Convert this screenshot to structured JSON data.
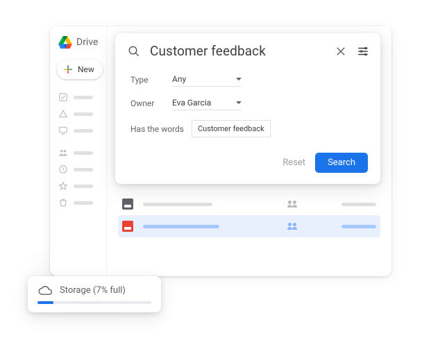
{
  "brand": {
    "name": "Drive"
  },
  "sidebar": {
    "new_label": "New"
  },
  "search": {
    "query": "Customer feedback",
    "filters": {
      "type_label": "Type",
      "type_value": "Any",
      "owner_label": "Owner",
      "owner_value": "Eva Garcia",
      "words_label": "Has the words",
      "words_value": "Customer feedback"
    },
    "actions": {
      "reset": "Reset",
      "search": "Search"
    }
  },
  "storage": {
    "label": "Storage (7% full)",
    "percent": 7
  }
}
